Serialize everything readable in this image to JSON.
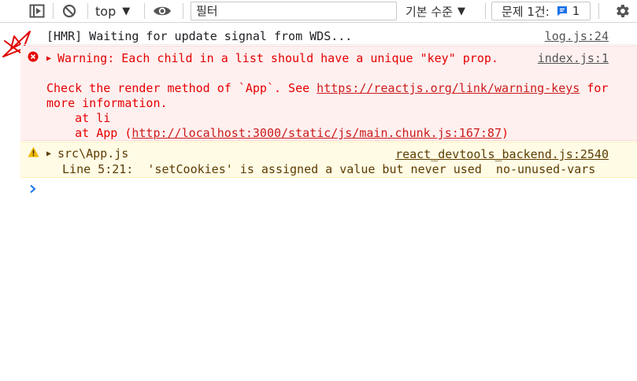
{
  "toolbar": {
    "context_label": "top",
    "filter_placeholder": "필터",
    "levels_label": "기본 수준",
    "issues_label": "문제 1건:",
    "issues_count": "1",
    "icons": {
      "sidebar": "sidebar-toggle-icon",
      "clear": "clear-console-icon",
      "dropdown": "caret-down-icon",
      "live_expression": "eye-icon",
      "issue": "chat-bubble-icon",
      "settings": "gear-icon"
    }
  },
  "messages": {
    "log": {
      "text": "[HMR] Waiting for update signal from WDS...",
      "source": "log.js:24"
    },
    "error": {
      "summary": "Warning: Each child in a list should have a unique \"key\" prop.",
      "source": "index.js:1",
      "detail_prefix": "Check the render method of `App`. See ",
      "detail_link": "https://reactjs.org/link/warning-keys",
      "detail_suffix": " for",
      "detail_line2": "more information.",
      "stack_1": "    at li",
      "stack_2_prefix": "    at App (",
      "stack_2_link": "http://localhost:3000/static/js/main.chunk.js:167:87",
      "stack_2_suffix": ")"
    },
    "warning": {
      "summary": "src\\App.js",
      "source": "react_devtools_backend.js:2540",
      "detail": " Line 5:21:  'setCookies' is assigned a value but never used  no-unused-vars"
    }
  },
  "colors": {
    "error_text": "#e50000",
    "error_bg": "#fff0f0",
    "warning_bg": "#fffbe5",
    "warning_icon": "#f2b800",
    "prompt": "#1a73e8",
    "annotation_red": "#e00000"
  }
}
